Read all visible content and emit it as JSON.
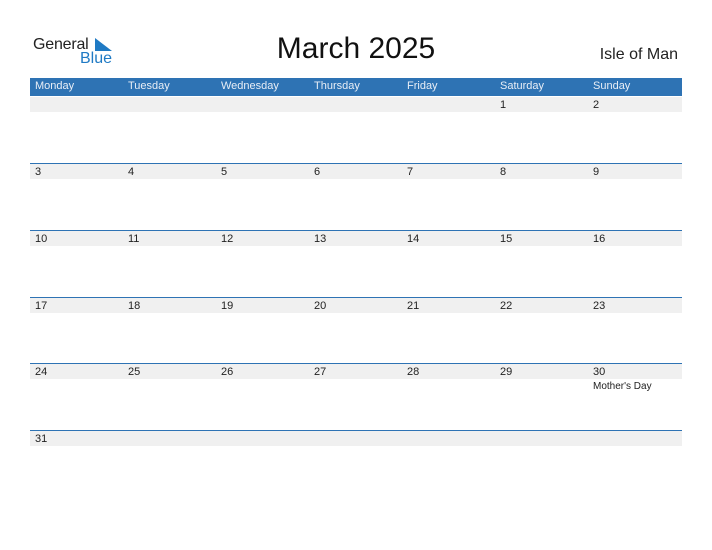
{
  "logo": {
    "general": "General",
    "blue": "Blue",
    "brand_color": "#1f7ac4"
  },
  "title": "March 2025",
  "region": "Isle of Man",
  "header_color": "#2e73b4",
  "weekdays": [
    "Monday",
    "Tuesday",
    "Wednesday",
    "Thursday",
    "Friday",
    "Saturday",
    "Sunday"
  ],
  "weeks": [
    [
      {
        "day": ""
      },
      {
        "day": ""
      },
      {
        "day": ""
      },
      {
        "day": ""
      },
      {
        "day": ""
      },
      {
        "day": "1"
      },
      {
        "day": "2"
      }
    ],
    [
      {
        "day": "3"
      },
      {
        "day": "4"
      },
      {
        "day": "5"
      },
      {
        "day": "6"
      },
      {
        "day": "7"
      },
      {
        "day": "8"
      },
      {
        "day": "9"
      }
    ],
    [
      {
        "day": "10"
      },
      {
        "day": "11"
      },
      {
        "day": "12"
      },
      {
        "day": "13"
      },
      {
        "day": "14"
      },
      {
        "day": "15"
      },
      {
        "day": "16"
      }
    ],
    [
      {
        "day": "17"
      },
      {
        "day": "18"
      },
      {
        "day": "19"
      },
      {
        "day": "20"
      },
      {
        "day": "21"
      },
      {
        "day": "22"
      },
      {
        "day": "23"
      }
    ],
    [
      {
        "day": "24"
      },
      {
        "day": "25"
      },
      {
        "day": "26"
      },
      {
        "day": "27"
      },
      {
        "day": "28"
      },
      {
        "day": "29"
      },
      {
        "day": "30",
        "event": "Mother's Day"
      }
    ],
    [
      {
        "day": "31"
      },
      {
        "day": ""
      },
      {
        "day": ""
      },
      {
        "day": ""
      },
      {
        "day": ""
      },
      {
        "day": ""
      },
      {
        "day": ""
      }
    ]
  ]
}
